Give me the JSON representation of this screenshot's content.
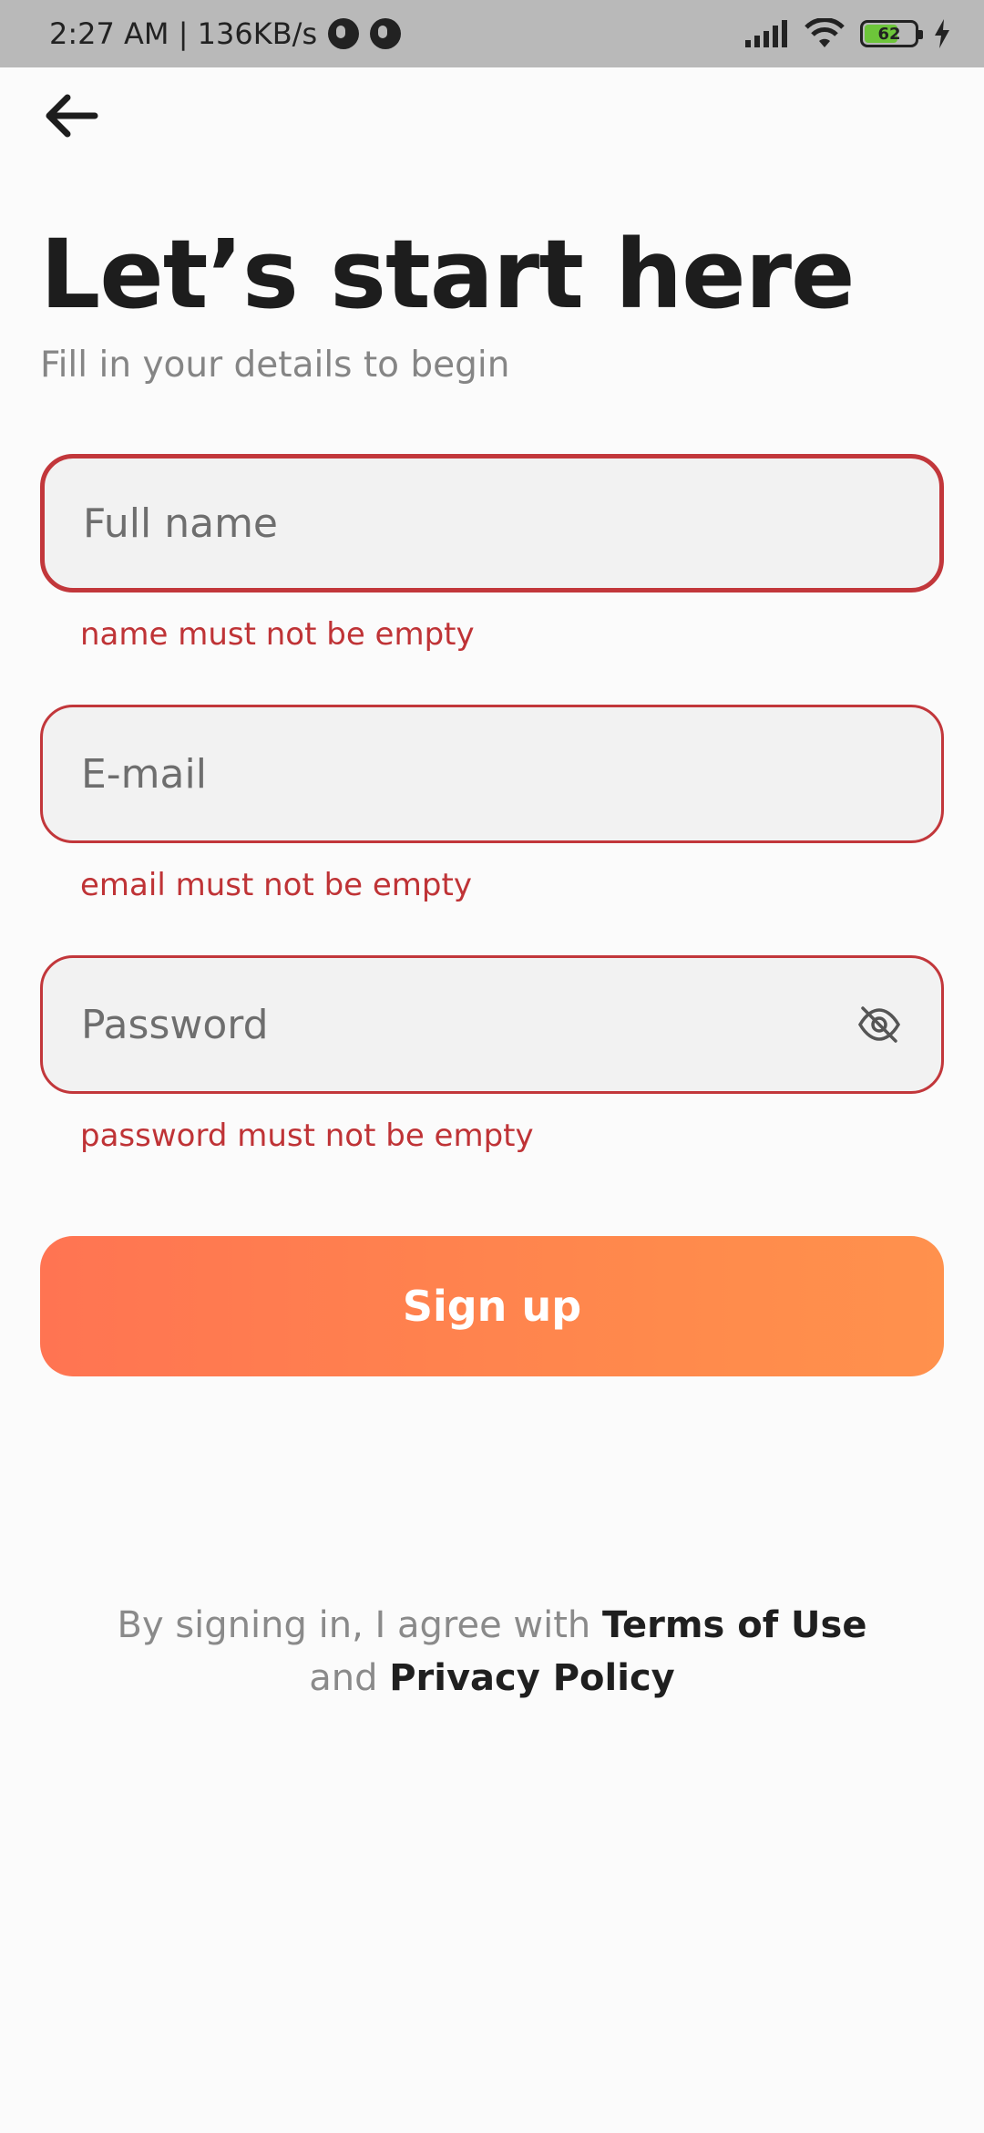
{
  "status": {
    "time_speed": "2:27 AM | 136KB/s",
    "battery_level": "62",
    "battery_color": "#6dc53a"
  },
  "header": {
    "back_icon": "arrow-left-icon",
    "title": "Let’s start here",
    "subtitle": "Fill in your details to begin"
  },
  "form": {
    "full_name": {
      "placeholder": "Full name",
      "error": "name must not be empty"
    },
    "email": {
      "placeholder": "E-mail",
      "error": "email must not be empty"
    },
    "password": {
      "placeholder": "Password",
      "error": "password must not be empty",
      "toggle_icon": "eye-off-icon"
    },
    "error_color": "#c2373b"
  },
  "actions": {
    "signup_label": "Sign up",
    "accent_start": "#ff7452",
    "accent_end": "#ff914d"
  },
  "footer": {
    "prefix": "By signing in, I agree with ",
    "terms_link": "Terms of Use",
    "middle": "and ",
    "privacy_link": "Privacy Policy"
  }
}
